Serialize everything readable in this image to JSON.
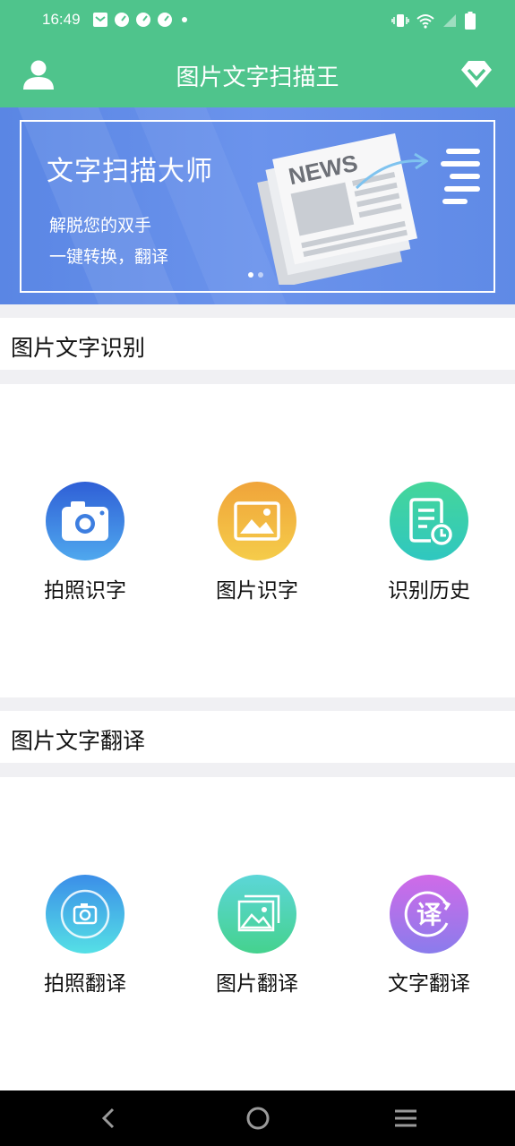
{
  "status_bar": {
    "time": "16:49"
  },
  "app": {
    "title": "图片文字扫描王"
  },
  "banner": {
    "title": "文字扫描大师",
    "subtitle_1": "解脱您的双手",
    "subtitle_2": "一键转换，翻译",
    "news_label": "NEWS"
  },
  "sections": {
    "recognition": {
      "title": "图片文字识别",
      "items": [
        {
          "label": "拍照识字",
          "icon": "camera-icon"
        },
        {
          "label": "图片识字",
          "icon": "image-icon"
        },
        {
          "label": "识别历史",
          "icon": "history-icon"
        }
      ]
    },
    "translation": {
      "title": "图片文字翻译",
      "items": [
        {
          "label": "拍照翻译",
          "icon": "camera-translate-icon"
        },
        {
          "label": "图片翻译",
          "icon": "image-translate-icon"
        },
        {
          "label": "文字翻译",
          "icon": "text-translate-icon"
        }
      ]
    }
  },
  "colors": {
    "header": "#4fc48c",
    "banner": "#6b93ec",
    "camera_gradient": [
      "#2f5fd6",
      "#4fa8ee"
    ],
    "image_gradient": [
      "#f0a43a",
      "#f5cc4a"
    ],
    "history_gradient": [
      "#45d69a",
      "#2fc7c0"
    ],
    "camera_translate_gradient": [
      "#3b8ee8",
      "#55e0e6"
    ],
    "image_translate_gradient": [
      "#5cd6d8",
      "#45d28e"
    ],
    "text_translate_gradient": [
      "#d06ae8",
      "#8a7cec"
    ]
  }
}
